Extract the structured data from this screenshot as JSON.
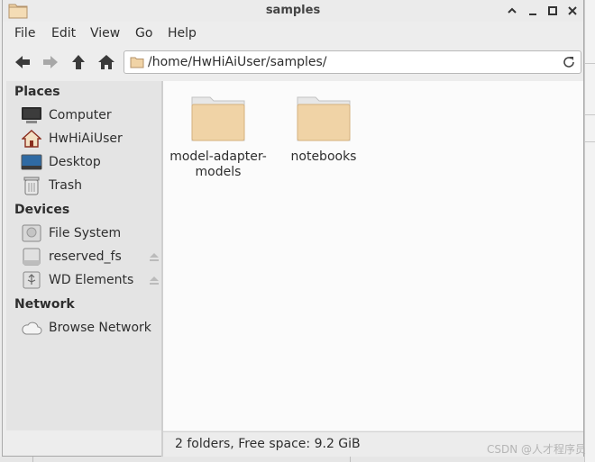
{
  "window": {
    "title": "samples"
  },
  "menu": [
    "File",
    "Edit",
    "View",
    "Go",
    "Help"
  ],
  "address": {
    "path": "/home/HwHiAiUser/samples/"
  },
  "sidebar": {
    "sections": [
      {
        "header": "Places",
        "items": [
          {
            "label": "Computer",
            "icon": "computer-icon"
          },
          {
            "label": "HwHiAiUser",
            "icon": "home-folder-icon"
          },
          {
            "label": "Desktop",
            "icon": "desktop-icon"
          },
          {
            "label": "Trash",
            "icon": "trash-icon"
          }
        ]
      },
      {
        "header": "Devices",
        "items": [
          {
            "label": "File System",
            "icon": "drive-icon"
          },
          {
            "label": "reserved_fs",
            "icon": "drive-icon",
            "ejectable": true
          },
          {
            "label": "WD Elements",
            "icon": "usb-drive-icon",
            "ejectable": true
          }
        ]
      },
      {
        "header": "Network",
        "items": [
          {
            "label": "Browse Network",
            "icon": "network-cloud-icon"
          }
        ]
      }
    ]
  },
  "files": [
    {
      "name_line1": "model-adapter-",
      "name_line2": "models",
      "type": "folder"
    },
    {
      "name_line1": "notebooks",
      "name_line2": "",
      "type": "folder"
    }
  ],
  "status": "2 folders, Free space: 9.2 GiB",
  "watermark": "CSDN @人才程序员",
  "colors": {
    "folder": "#f0d3a6",
    "folder_dark": "#d9b47e",
    "accent": "#3a3a3a"
  }
}
